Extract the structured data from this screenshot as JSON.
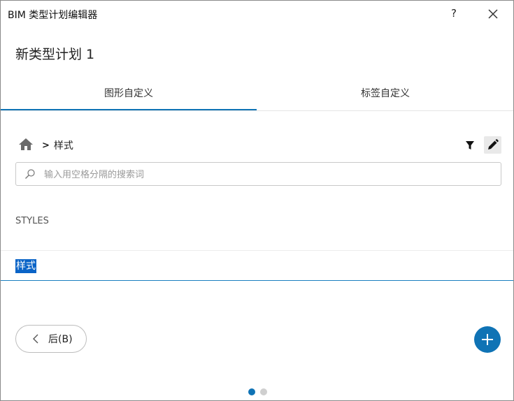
{
  "window": {
    "title": "BIM 类型计划编辑器",
    "help_label": "?"
  },
  "page": {
    "title": "新类型计划 1"
  },
  "tabs": [
    {
      "label": "图形自定义",
      "active": true
    },
    {
      "label": "标签自定义",
      "active": false
    }
  ],
  "breadcrumb": {
    "home_icon": "home-icon",
    "separator": ">",
    "current": "样式"
  },
  "toolbar": {
    "filter_icon": "filter-icon",
    "edit_icon": "pencil-icon"
  },
  "search": {
    "placeholder": "输入用空格分隔的搜索词",
    "value": ""
  },
  "list": {
    "section_header": "STYLES",
    "items": [
      {
        "label": "样式",
        "selected": true
      }
    ]
  },
  "footer": {
    "back_label": "后(B)",
    "add_icon": "plus-icon",
    "pager": {
      "current": 1,
      "total": 2
    }
  },
  "colors": {
    "accent": "#0f73b5",
    "selection": "#0a64c7"
  }
}
